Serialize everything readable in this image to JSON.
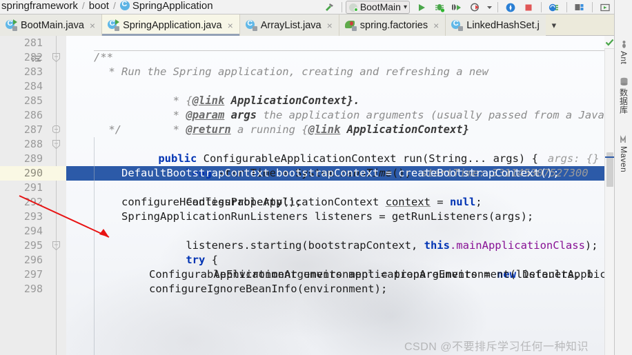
{
  "window": {
    "breadcrumb": [
      "springframework",
      "boot",
      "SpringApplication"
    ],
    "breadcrumb_separator": "/"
  },
  "toolbar": {
    "run_config_name": "BootMain",
    "run_config_dropdown": "▾",
    "buttons": [
      {
        "name": "run-button",
        "label": "Run"
      },
      {
        "name": "debug-button",
        "label": "Debug"
      },
      {
        "name": "run-with-coverage-button",
        "label": "Run with Coverage"
      },
      {
        "name": "profiler-button",
        "label": "Profiler"
      },
      {
        "name": "profiler-dropdown",
        "label": "▾"
      },
      {
        "name": "update-application-button",
        "label": "Update Application"
      },
      {
        "name": "stop-button",
        "label": "Stop"
      },
      {
        "name": "attach-debugger-button",
        "label": "Attach Debugger to Process"
      },
      {
        "name": "layout-button",
        "label": "Layout"
      },
      {
        "name": "run-anything-button",
        "label": "Run Anything"
      },
      {
        "name": "search-everywhere-button",
        "label": "Search Everywhere"
      }
    ]
  },
  "tabs": {
    "items": [
      {
        "label": "BootMain.java",
        "icon": "java-class-runnable-icon",
        "active": false,
        "close": "×"
      },
      {
        "label": "SpringApplication.java",
        "icon": "java-class-readonly-icon",
        "active": true,
        "close": "×"
      },
      {
        "label": "ArrayList.java",
        "icon": "java-class-readonly-icon",
        "active": false,
        "close": "×"
      },
      {
        "label": "spring.factories",
        "icon": "spring-factories-icon",
        "active": false,
        "close": "×"
      },
      {
        "label": "LinkedHashSet.j",
        "icon": "java-class-readonly-icon",
        "active": false,
        "close": ""
      }
    ],
    "overflow_label": "▾"
  },
  "editor": {
    "current_line": 290,
    "lines": [
      {
        "num": "281",
        "fold": "",
        "mark": false
      },
      {
        "num": "282",
        "fold": "end",
        "mark": true
      },
      {
        "num": "283",
        "fold": "",
        "mark": false
      },
      {
        "num": "284",
        "fold": "",
        "mark": false
      },
      {
        "num": "285",
        "fold": "",
        "mark": false
      },
      {
        "num": "286",
        "fold": "",
        "mark": false
      },
      {
        "num": "287",
        "fold": "mid",
        "mark": false
      },
      {
        "num": "288",
        "fold": "end",
        "mark": false
      },
      {
        "num": "289",
        "fold": "",
        "mark": false
      },
      {
        "num": "290",
        "fold": "",
        "mark": false
      },
      {
        "num": "291",
        "fold": "",
        "mark": false
      },
      {
        "num": "292",
        "fold": "",
        "mark": false
      },
      {
        "num": "293",
        "fold": "",
        "mark": false
      },
      {
        "num": "294",
        "fold": "",
        "mark": false
      },
      {
        "num": "295",
        "fold": "end",
        "mark": false
      },
      {
        "num": "296",
        "fold": "",
        "mark": false
      },
      {
        "num": "297",
        "fold": "",
        "mark": false
      },
      {
        "num": "298",
        "fold": "",
        "mark": false
      }
    ],
    "code": {
      "l281": "",
      "l282": "/**",
      "l283_pre": " * Run the Spring application, creating and refreshing a new",
      "l284_a": " * {",
      "l284_link": "@link",
      "l284_b": " ApplicationContext",
      "l284_c": "}.",
      "l285_a": " * ",
      "l285_tag": "@param",
      "l285_args": " args",
      "l285_b": " the application arguments (usually passed from a Java main met",
      "l286_a": " * ",
      "l286_tag": "@return",
      "l286_b": " a running {",
      "l286_link": "@link",
      "l286_c": " ApplicationContext}",
      "l287": " */",
      "l288_kw": "public",
      "l288_sig": " ConfigurableApplicationContext run(String... args) {",
      "l288_dbg": "args: {}",
      "l289_kw": "long",
      "l289_a": " startTime = System.",
      "l289_stat": "nanoTime",
      "l289_b": "();",
      "l289_dbg": "startTime: 331145307527300",
      "l290": "DefaultBootstrapContext bootstrapContext = createBootstrapContext();",
      "l291_a": "ConfigurableApplicationContext ",
      "l291_var": "context",
      "l291_b": " = ",
      "l291_kw": "null",
      "l291_c": ";",
      "l292": "configureHeadlessProperty();",
      "l293": "SpringApplicationRunListeners listeners = getRunListeners(args);",
      "l294_a": "listeners.starting(bootstrapContext, ",
      "l294_kw": "this",
      "l294_dot": ".",
      "l294_fld": "mainApplicationClass",
      "l294_b": ");",
      "l295_kw": "try",
      "l295_b": " {",
      "l296_a": "ApplicationArguments applicationArguments = ",
      "l296_kw": "new",
      "l296_b": " DefaultApplicationArg",
      "l297": "ConfigurableEnvironment environment = prepareEnvironment(listeners, b",
      "l298": "configureIgnoreBeanInfo(environment);"
    }
  },
  "right_tool_window": {
    "items": [
      {
        "label": "Ant",
        "icon": "ant-icon"
      },
      {
        "label": "数据库",
        "icon": "database-icon"
      },
      {
        "label": "Maven",
        "icon": "maven-icon"
      }
    ]
  },
  "inspections": {
    "status_icon": "checkmark-icon",
    "status_color": "#4aa64a"
  },
  "watermark": {
    "text": "CSDN @不要排斥学习任何一种知识"
  },
  "colors": {
    "selection_blue": "#2c5aa8",
    "current_line_gutter": "#faf8e4",
    "tab_active_bg": "#f7f6e7",
    "keyword_blue": "#0033b3",
    "field_purple": "#871094",
    "comment_gray": "#8c8c8c",
    "annotation_red": "#e81313"
  }
}
